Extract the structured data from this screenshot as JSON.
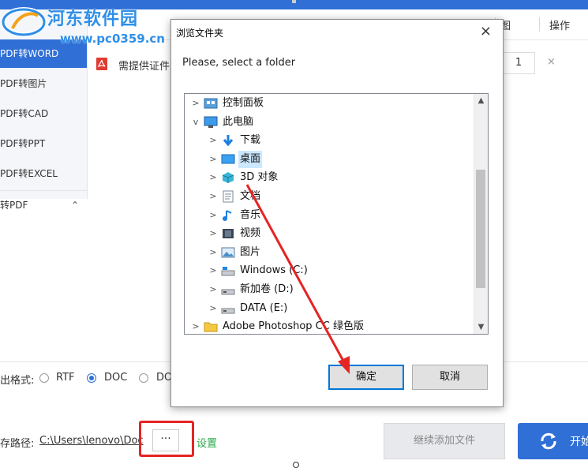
{
  "app": {
    "operation_label": "操作",
    "header_fragment": "图",
    "sidebar": {
      "items": [
        {
          "label": "PDF转WORD"
        },
        {
          "label": "PDF转图片"
        },
        {
          "label": "PDF转CAD"
        },
        {
          "label": "PDF转PPT"
        },
        {
          "label": "PDF转EXCEL"
        },
        {
          "label": "转PDF"
        }
      ]
    },
    "file_row": {
      "name": "需提供证件",
      "page_value": "1",
      "remove": "×"
    },
    "format": {
      "label": "出格式:",
      "options": [
        {
          "label": "RTF",
          "checked": false
        },
        {
          "label": "DOC",
          "checked": true
        },
        {
          "label": "DO",
          "checked": false
        }
      ]
    },
    "save": {
      "label": "存路径:",
      "path": "C:\\Users\\lenovo\\Doc",
      "browse_label": "···",
      "settings_label": "设置"
    },
    "add_files_label": "继续添加文件",
    "start_label": "开始"
  },
  "watermark": {
    "title": "河东软件园",
    "url": "www.pc0359.cn"
  },
  "dialog": {
    "title": "浏览文件夹",
    "close": "×",
    "prompt": "Please, select a folder",
    "tree": [
      {
        "label": "控制面板",
        "icon": "control-panel-icon",
        "expander": ">",
        "selected": false
      },
      {
        "label": "此电脑",
        "icon": "computer-icon",
        "expander": "v",
        "selected": false
      },
      {
        "label": "下载",
        "icon": "download-icon",
        "expander": ">",
        "selected": false
      },
      {
        "label": "桌面",
        "icon": "desktop-icon",
        "expander": ">",
        "selected": true
      },
      {
        "label": "3D 对象",
        "icon": "3d-objects-icon",
        "expander": ">",
        "selected": false
      },
      {
        "label": "文档",
        "icon": "documents-icon",
        "expander": ">",
        "selected": false
      },
      {
        "label": "音乐",
        "icon": "music-icon",
        "expander": ">",
        "selected": false
      },
      {
        "label": "视频",
        "icon": "video-icon",
        "expander": ">",
        "selected": false
      },
      {
        "label": "图片",
        "icon": "pictures-icon",
        "expander": ">",
        "selected": false
      },
      {
        "label": "Windows (C:)",
        "icon": "drive-c-icon",
        "expander": ">",
        "selected": false
      },
      {
        "label": "新加卷 (D:)",
        "icon": "drive-d-icon",
        "expander": ">",
        "selected": false
      },
      {
        "label": "DATA (E:)",
        "icon": "drive-e-icon",
        "expander": ">",
        "selected": false
      },
      {
        "label": "Adobe Photoshop CC 绿色版",
        "icon": "folder-icon",
        "expander": ">",
        "selected": false
      }
    ],
    "ok_label": "确定",
    "cancel_label": "取消"
  },
  "colors": {
    "brand": "#2f6fd6",
    "annotation": "#e52424",
    "watermark": "#2f8fe8"
  }
}
